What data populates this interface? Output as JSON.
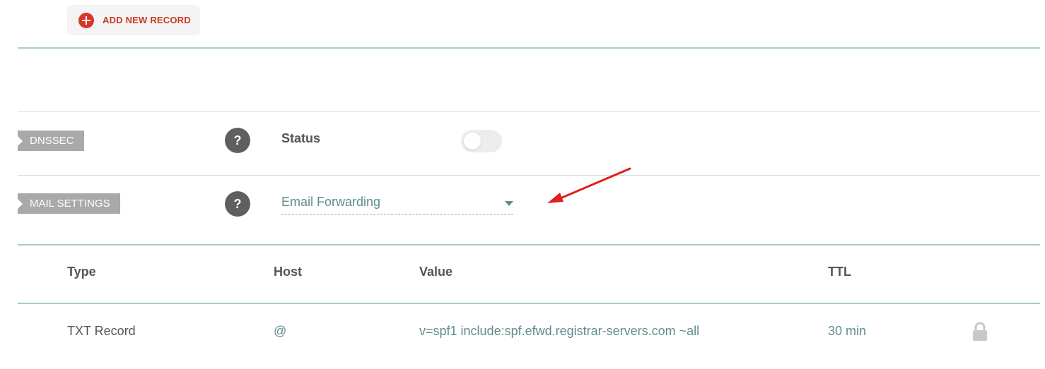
{
  "toolbar": {
    "add_record_label": "ADD NEW RECORD"
  },
  "dnssec": {
    "tag_label": "DNSSEC",
    "help_symbol": "?",
    "status_label": "Status",
    "enabled": false
  },
  "mail_settings": {
    "tag_label": "MAIL SETTINGS",
    "help_symbol": "?",
    "selected_value": "Email Forwarding"
  },
  "table": {
    "columns": [
      "Type",
      "Host",
      "Value",
      "TTL"
    ],
    "rows": [
      {
        "type": "TXT Record",
        "host": "@",
        "value": "v=spf1 include:spf.efwd.registrar-servers.com ~all",
        "ttl": "30 min",
        "locked": true
      }
    ]
  },
  "colors": {
    "accent_red": "#d6362a",
    "teal": "#5e8e8b",
    "divider_teal": "#a7cdcb",
    "tag_grey": "#a9a9a9",
    "annotation_arrow": "#e0201c"
  },
  "icons": {
    "add": "plus-circle-icon",
    "help": "question-icon",
    "dropdown": "caret-down-icon",
    "lock": "lock-icon",
    "annotation": "red-arrow-annotation"
  }
}
